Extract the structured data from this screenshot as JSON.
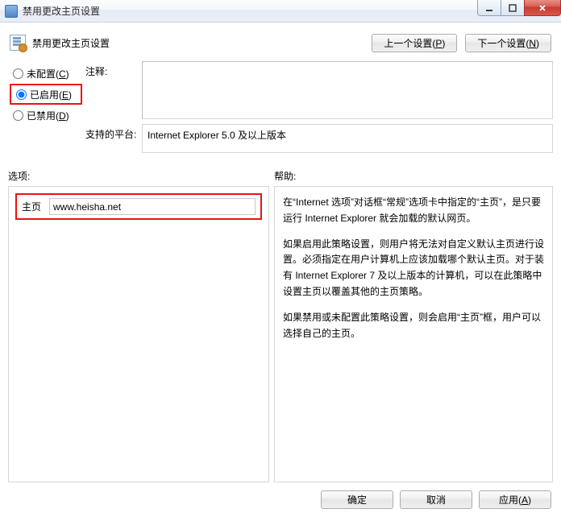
{
  "window": {
    "title": "禁用更改主页设置"
  },
  "header": {
    "page_title": "禁用更改主页设置",
    "prev_btn": "上一个设置(P)",
    "next_btn": "下一个设置(N)"
  },
  "state": {
    "not_configured": "未配置(C)",
    "enabled": "已启用(E)",
    "disabled": "已禁用(D)",
    "selected": "enabled"
  },
  "comment": {
    "label": "注释:",
    "value": ""
  },
  "platform": {
    "label": "支持的平台:",
    "value": "Internet Explorer 5.0 及以上版本"
  },
  "columns": {
    "options": "选项:",
    "help": "帮助:"
  },
  "options": {
    "homepage_label": "主页",
    "homepage_value": "www.heisha.net"
  },
  "help": {
    "p1": "在“Internet 选项”对话框“常规”选项卡中指定的“主页”，是只要运行 Internet Explorer 就会加载的默认网页。",
    "p2": "如果启用此策略设置，则用户将无法对自定义默认主页进行设置。必须指定在用户计算机上应该加载哪个默认主页。对于装有 Internet Explorer 7 及以上版本的计算机，可以在此策略中设置主页以覆盖其他的主页策略。",
    "p3": "如果禁用或未配置此策略设置，则会启用“主页”框，用户可以选择自己的主页。"
  },
  "footer": {
    "ok": "确定",
    "cancel": "取消",
    "apply": "应用(A)"
  }
}
